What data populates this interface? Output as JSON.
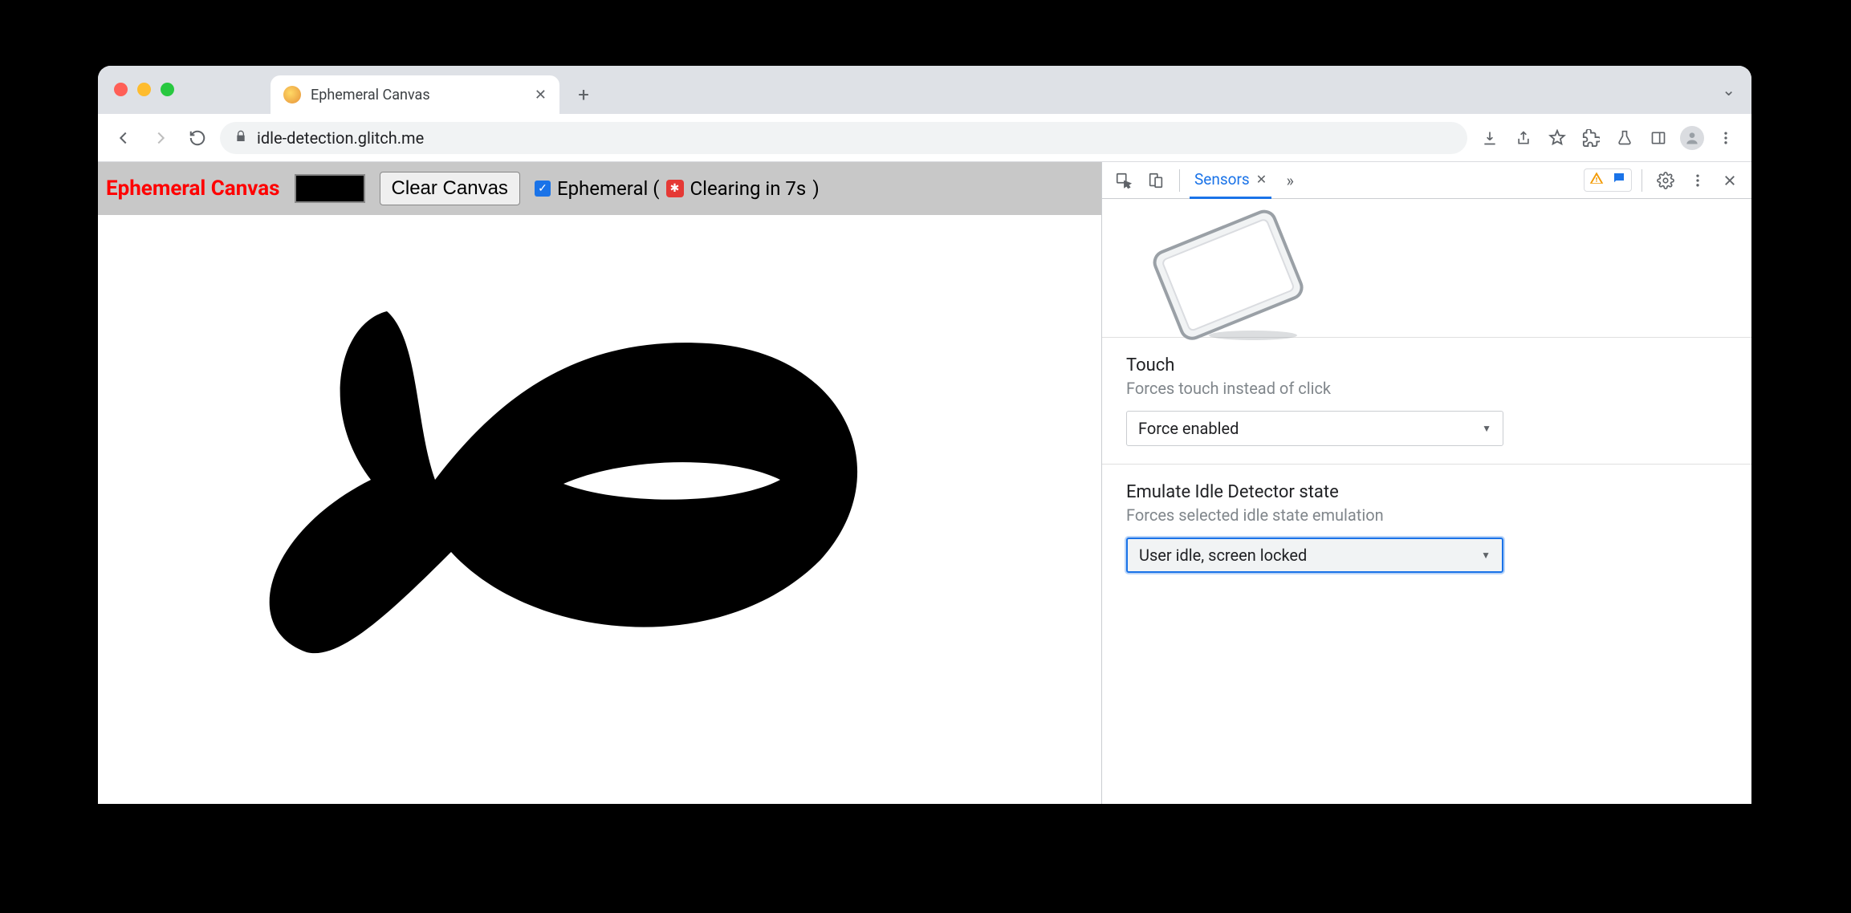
{
  "browser": {
    "tab_title": "Ephemeral Canvas",
    "url": "idle-detection.glitch.me",
    "icons": {
      "back": "←",
      "forward": "→",
      "reload": "⟳",
      "lock": "🔒",
      "download": "⤓",
      "share": "⇧",
      "star": "☆",
      "puzzle": "✦",
      "flask": "⚗",
      "panel": "▣",
      "menu": "⋮",
      "overflow": "⌄",
      "newtab": "+",
      "tabclose": "✕"
    }
  },
  "app": {
    "title": "Ephemeral Canvas",
    "clear_button": "Clear Canvas",
    "ephemeral_label_prefix": "Ephemeral (",
    "ephemeral_countdown": "Clearing in 7s",
    "ephemeral_label_suffix": ")",
    "current_color": "#000000",
    "ephemeral_checked": true
  },
  "devtools": {
    "active_tab": "Sensors",
    "tab_close": "✕",
    "more": "»",
    "sections": {
      "touch": {
        "title": "Touch",
        "subtitle": "Forces touch instead of click",
        "value": "Force enabled"
      },
      "idle": {
        "title": "Emulate Idle Detector state",
        "subtitle": "Forces selected idle state emulation",
        "value": "User idle, screen locked"
      }
    }
  }
}
